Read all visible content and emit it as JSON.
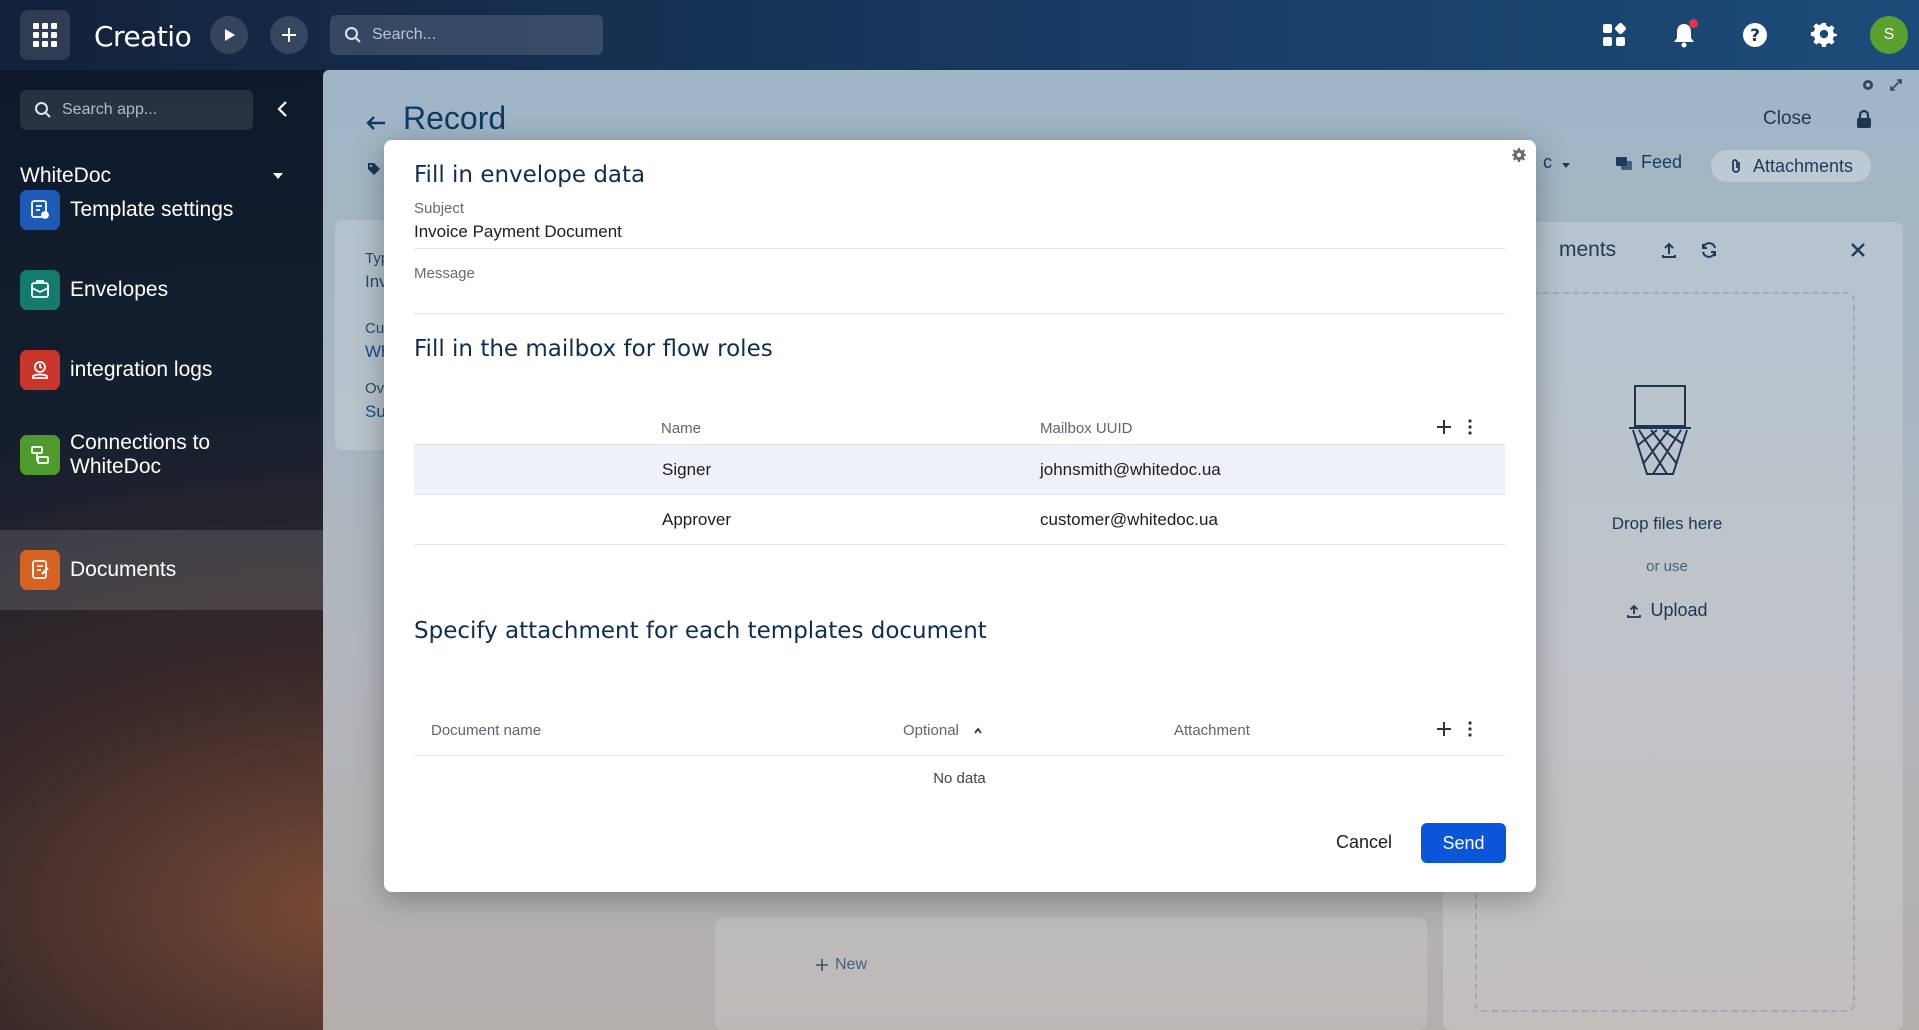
{
  "topbar": {
    "logo": "Creatio",
    "search_placeholder": "Search...",
    "avatar_letter": "S"
  },
  "sidebar": {
    "search_placeholder": "Search app...",
    "app_name": "WhiteDoc",
    "items": [
      {
        "label": "Template settings",
        "color": "#1e5bb8"
      },
      {
        "label": "Envelopes",
        "color": "#157a6e"
      },
      {
        "label": "integration logs",
        "color": "#c8362c"
      },
      {
        "label": "Connections to WhiteDoc",
        "color": "#4e9a2a"
      },
      {
        "label": "Documents",
        "color": "#d5621e"
      }
    ]
  },
  "record": {
    "title": "Record",
    "close_label": "Close",
    "feed_label": "Feed",
    "attachments_label": "Attachments",
    "dropdown_fragment": "c",
    "left_card": {
      "type_label": "Typ",
      "type_value": "Inv",
      "customer_label": "Cu",
      "customer_value": "Wh",
      "owner_label": "Ov",
      "owner_value": "Su"
    },
    "new_label": "New",
    "attachments_panel": {
      "title": "ments",
      "drop_text": "Drop files here",
      "or_use": "or use",
      "upload_label": "Upload"
    }
  },
  "modal": {
    "envelope_title": "Fill in envelope data",
    "subject_label": "Subject",
    "subject_value": "Invoice Payment Document",
    "message_label": "Message",
    "message_value": "",
    "roles_title": "Fill in the mailbox for flow roles",
    "roles_table": {
      "columns": [
        "Name",
        "Mailbox UUID"
      ],
      "rows": [
        {
          "name": "Signer",
          "mailbox": "johnsmith@whitedoc.ua"
        },
        {
          "name": "Approver",
          "mailbox": "customer@whitedoc.ua"
        }
      ]
    },
    "docs_title": "Specify attachment for each templates document",
    "docs_table": {
      "columns": [
        "Document name",
        "Optional",
        "Attachment"
      ],
      "empty_text": "No data"
    },
    "cancel_label": "Cancel",
    "send_label": "Send"
  },
  "colors": {
    "primary_button": "#0b56d8",
    "heading": "#0e2f4f",
    "notification_dot": "#e8344a",
    "avatar": "#5aa02c"
  }
}
